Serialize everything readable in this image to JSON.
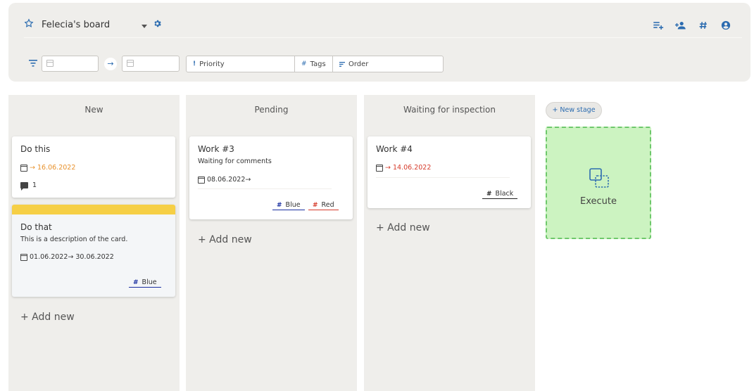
{
  "header": {
    "board_title": "Felecia's board",
    "icons": [
      "star-icon",
      "chevron-down-icon",
      "gear-icon",
      "add-list-icon",
      "add-user-icon",
      "hashtag-icon",
      "account-icon"
    ]
  },
  "filters": {
    "date_from": "",
    "date_to": "",
    "priority_placeholder": "Priority",
    "tags_placeholder": "Tags",
    "order_placeholder": "Order"
  },
  "columns": [
    {
      "title": "New",
      "add_new_label": "+ Add new",
      "cards": [
        {
          "title": "Do this",
          "date": "→ 16.06.2022",
          "date_color": "#e8912b",
          "comments": "1"
        },
        {
          "title": "Do that",
          "description": "This is a description of the card.",
          "date": "01.06.2022→ 30.06.2022",
          "color_bar": "#f6cf45",
          "tags": [
            {
              "label": "Blue",
              "color": "#1a2fa0"
            }
          ]
        }
      ]
    },
    {
      "title": "Pending",
      "add_new_label": "+ Add new",
      "cards": [
        {
          "title": "Work #3",
          "description": "Waiting for comments",
          "date": "08.06.2022→",
          "tags": [
            {
              "label": "Blue",
              "color": "#1a2fa0"
            },
            {
              "label": "Red",
              "color": "#d63a2a"
            }
          ]
        }
      ]
    },
    {
      "title": "Waiting for inspection",
      "add_new_label": "+ Add new",
      "cards": [
        {
          "title": "Work #4",
          "date": "→ 14.06.2022",
          "date_color": "#d63a2a",
          "tags": [
            {
              "label": "Black",
              "color": "#222222"
            }
          ]
        }
      ]
    }
  ],
  "new_stage_label": "+ New stage",
  "execute_label": "Execute",
  "colors": {
    "accent": "#2c6cb0",
    "execute_bg": "#ccf3c1",
    "execute_border": "#6ec86b"
  }
}
